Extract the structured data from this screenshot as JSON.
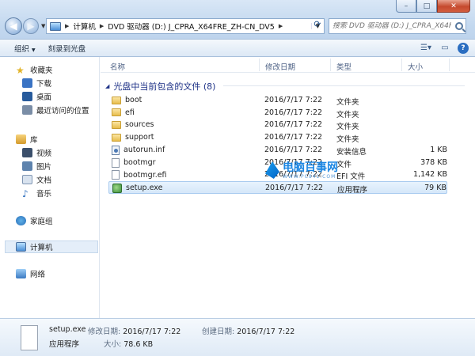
{
  "window": {
    "minimize": "–",
    "maximize": "□",
    "close": "✕"
  },
  "address": {
    "segments": [
      "计算机",
      "DVD 驱动器 (D:) J_CPRA_X64FRE_ZH-CN_DV5"
    ],
    "search_placeholder": "搜索 DVD 驱动器 (D:) J_CPRA_X64F..."
  },
  "toolbar": {
    "organize": "组织",
    "burn": "刻录到光盘"
  },
  "nav": {
    "favorites": {
      "label": "收藏夹",
      "items": [
        "下载",
        "桌面",
        "最近访问的位置"
      ]
    },
    "libraries": {
      "label": "库",
      "items": [
        "视频",
        "图片",
        "文档",
        "音乐"
      ]
    },
    "homegroup": "家庭组",
    "computer": "计算机",
    "network": "网络"
  },
  "columns": {
    "name": "名称",
    "modified": "修改日期",
    "type": "类型",
    "size": "大小"
  },
  "group_title": "光盘中当前包含的文件 (8)",
  "files": [
    {
      "name": "boot",
      "date": "2016/7/17 7:22",
      "type": "文件夹",
      "size": "",
      "icon": "folder-icon"
    },
    {
      "name": "efi",
      "date": "2016/7/17 7:22",
      "type": "文件夹",
      "size": "",
      "icon": "folder-icon"
    },
    {
      "name": "sources",
      "date": "2016/7/17 7:22",
      "type": "文件夹",
      "size": "",
      "icon": "folder-icon"
    },
    {
      "name": "support",
      "date": "2016/7/17 7:22",
      "type": "文件夹",
      "size": "",
      "icon": "folder-icon"
    },
    {
      "name": "autorun.inf",
      "date": "2016/7/17 7:22",
      "type": "安装信息",
      "size": "1 KB",
      "icon": "setup-info-icon"
    },
    {
      "name": "bootmgr",
      "date": "2016/7/17 7:22",
      "type": "文件",
      "size": "378 KB",
      "icon": "file-icon"
    },
    {
      "name": "bootmgr.efi",
      "date": "2016/7/17 7:22",
      "type": "EFI 文件",
      "size": "1,142 KB",
      "icon": "file-icon"
    },
    {
      "name": "setup.exe",
      "date": "2016/7/17 7:22",
      "type": "应用程序",
      "size": "79 KB",
      "icon": "application-icon"
    }
  ],
  "watermark": {
    "title": "电脑百事网",
    "sub": "WWW.PC841.COM"
  },
  "details": {
    "name": "setup.exe",
    "type": "应用程序",
    "modified_label": "修改日期:",
    "modified_value": "2016/7/17 7:22",
    "created_label": "创建日期:",
    "created_value": "2016/7/17 7:22",
    "size_label": "大小:",
    "size_value": "78.6 KB"
  }
}
